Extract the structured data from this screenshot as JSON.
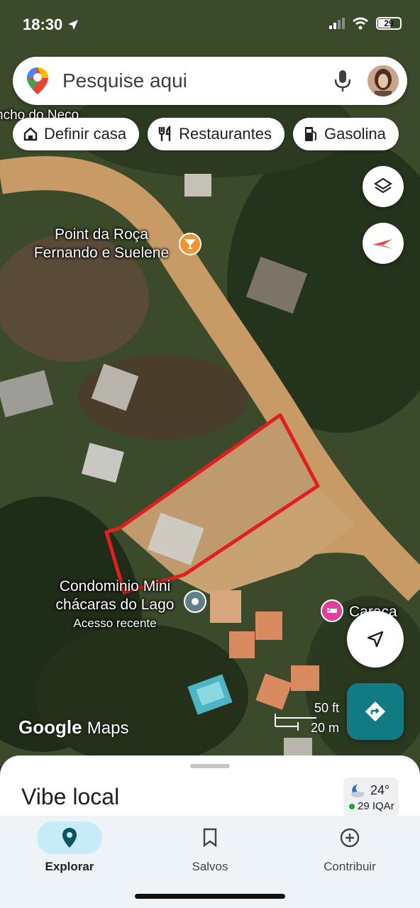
{
  "status_bar": {
    "time": "18:30",
    "battery": "29"
  },
  "search": {
    "placeholder": "Pesquise aqui"
  },
  "chips": [
    {
      "label": "Definir casa",
      "icon": "home-icon"
    },
    {
      "label": "Restaurantes",
      "icon": "restaurant-icon"
    },
    {
      "label": "Gasolina",
      "icon": "gas-station-icon"
    }
  ],
  "map": {
    "top_partial_label": "ncho do Neco",
    "poi_bar": {
      "line1": "Point da Roça",
      "line2": "Fernando e Suelene",
      "icon": "bar-icon",
      "color": "#f29432"
    },
    "poi_condo": {
      "line1": "Condominio Mini",
      "line2": "chácaras do Lago",
      "sub": "Acesso recente",
      "icon": "recent-pin-icon",
      "color": "#5f7f8a"
    },
    "poi_hotel": {
      "label": "Caraça",
      "icon": "hotel-icon",
      "color": "#e0409a"
    },
    "boundary_color": "#e0201f",
    "google_logo": "Google",
    "maps_word": "Maps",
    "scale_ft": "50 ft",
    "scale_m": "20 m"
  },
  "sheet": {
    "title": "Vibe local"
  },
  "weather": {
    "temp": "24°",
    "aq": "29 IQAr"
  },
  "nav": [
    {
      "label": "Explorar",
      "icon": "explore-pin-icon",
      "active": true
    },
    {
      "label": "Salvos",
      "icon": "bookmark-icon",
      "active": false
    },
    {
      "label": "Contribuir",
      "icon": "add-circle-icon",
      "active": false
    }
  ]
}
